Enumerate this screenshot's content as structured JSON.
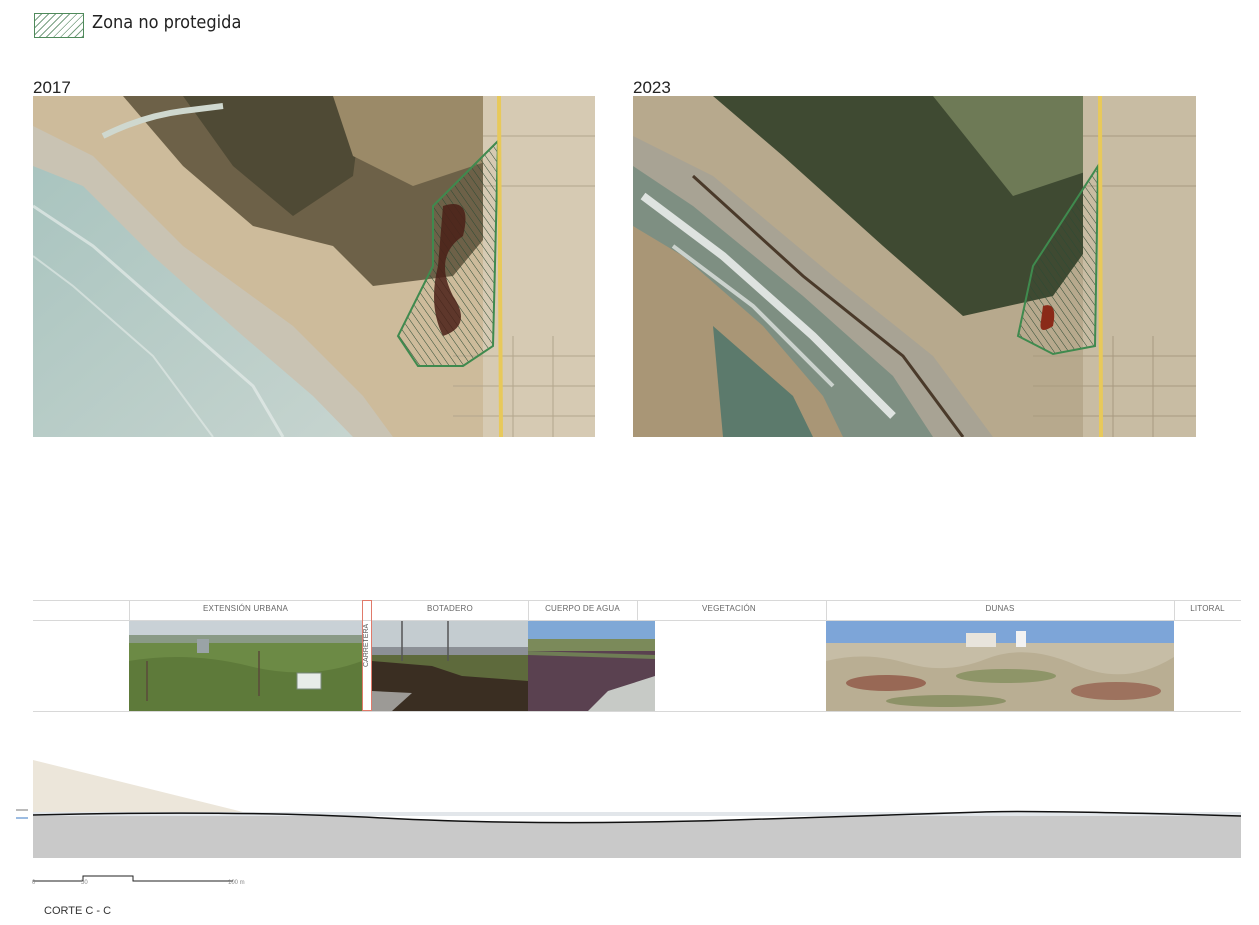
{
  "legend": {
    "label": "Zona no protegida"
  },
  "maps": [
    {
      "year": "2017"
    },
    {
      "year": "2023"
    }
  ],
  "section": {
    "zones": [
      "EXTENSIÓN URBANA",
      "BOTADERO",
      "CUERPO DE AGUA",
      "VEGETACIÓN",
      "DUNAS",
      "LITORAL"
    ],
    "road_label": "CARRETERA",
    "title": "CORTE C - C",
    "scale": {
      "ticks": [
        "0",
        "50",
        "100 m"
      ]
    }
  },
  "colors": {
    "legend_border": "#4f8a5b",
    "protected_outline": "#3f8a4e",
    "road": "#e8c95a",
    "ground": "#c9c9c9",
    "terrain_line": "#111111"
  }
}
